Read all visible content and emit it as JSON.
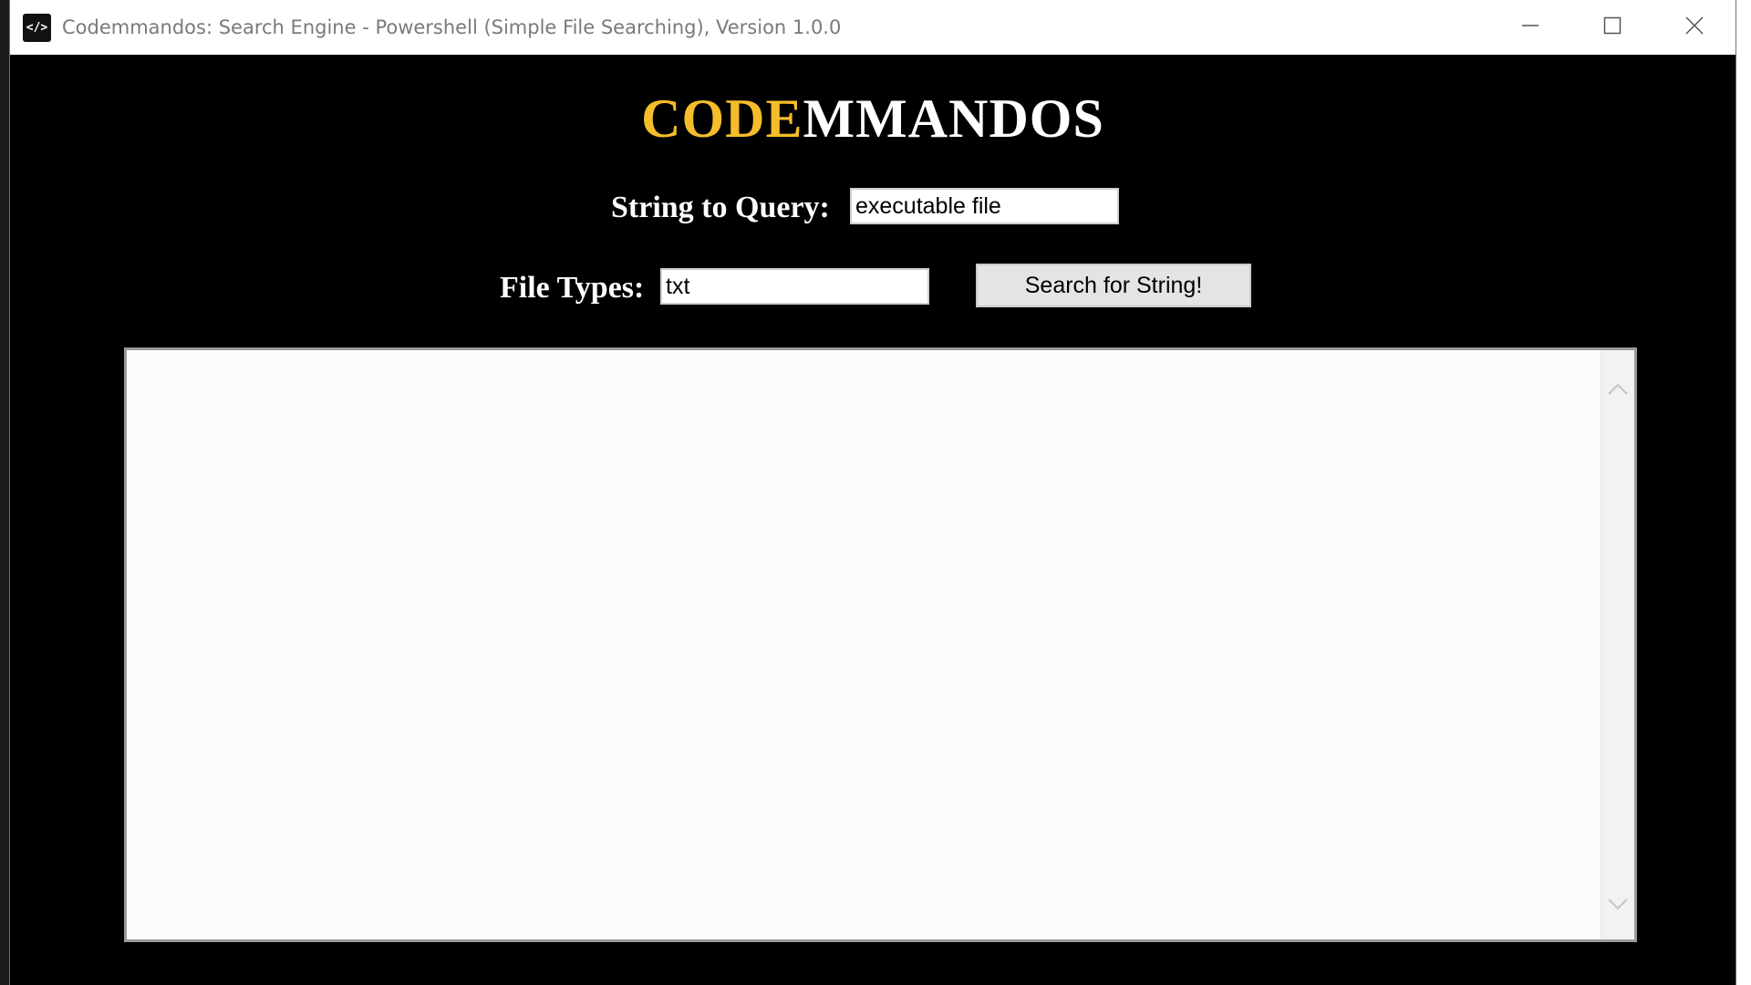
{
  "window": {
    "title": "Codemmandos: Search Engine - Powershell (Simple File Searching), Version 1.0.0",
    "app_icon_text": "</>"
  },
  "brand": {
    "highlight": "CODE",
    "rest": "MMANDOS",
    "highlight_color": "#f5bd2a"
  },
  "query": {
    "label": "String to Query:",
    "value": "executable file"
  },
  "file_types": {
    "label": "File Types:",
    "value": "txt"
  },
  "search_button": {
    "label": "Search for String!"
  },
  "results": {
    "text": ""
  }
}
